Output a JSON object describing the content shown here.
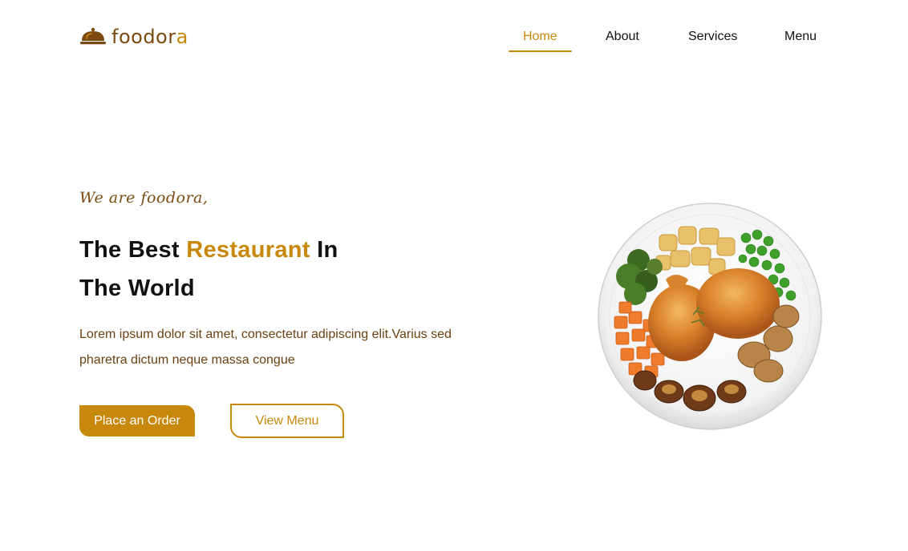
{
  "brand": {
    "name_main": "foodor",
    "name_accent": "a"
  },
  "nav": {
    "items": [
      {
        "label": "Home",
        "active": true
      },
      {
        "label": "About",
        "active": false
      },
      {
        "label": "Services",
        "active": false
      },
      {
        "label": "Menu",
        "active": false
      }
    ]
  },
  "hero": {
    "eyebrow": "We are foodora,",
    "headline_part1": "The Best ",
    "headline_highlight": "Restaurant",
    "headline_part2": " In",
    "headline_line2": "The World",
    "description": "Lorem ipsum dolor sit amet, consectetur adipiscing elit.Varius sed pharetra dictum neque massa congue",
    "primary_button": "Place an Order",
    "secondary_button": "View Menu",
    "image_icon": "food-plate-image"
  },
  "colors": {
    "accent": "#c8880c",
    "brand_brown": "#7a4a10",
    "text_dark": "#111111"
  }
}
